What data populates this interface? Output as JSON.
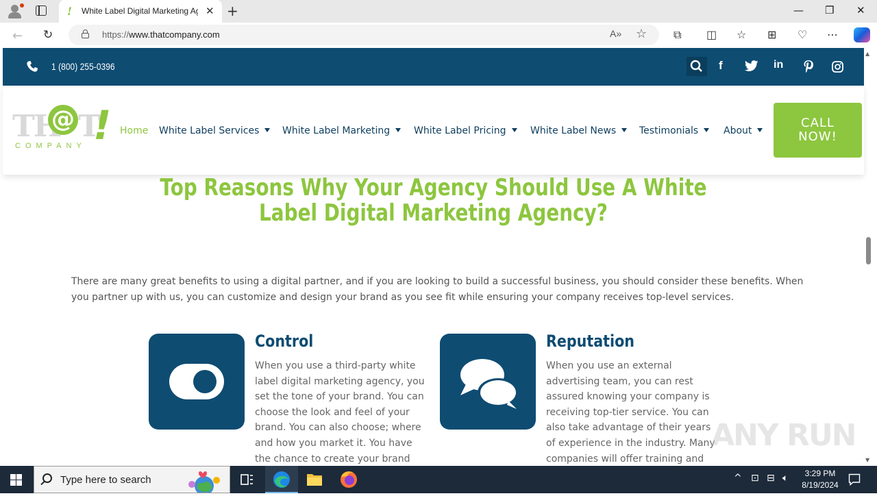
{
  "browser": {
    "tab_title": "White Label Digital Marketing Ag",
    "url_proto": "https://",
    "url_rest": "www.thatcompany.com"
  },
  "topbar": {
    "phone": "1 (800) 255-0396",
    "social": [
      "facebook-icon",
      "twitter-icon",
      "linkedin-icon",
      "pinterest-icon",
      "instagram-icon"
    ]
  },
  "logo": {
    "th": "TH",
    "at": "@",
    "t": "T",
    "bang": "!",
    "company": "COMPANY"
  },
  "nav": {
    "items": [
      {
        "label": "Home"
      },
      {
        "label": "White Label Services"
      },
      {
        "label": "White Label Marketing"
      },
      {
        "label": "White Label Pricing"
      },
      {
        "label": "White Label News"
      },
      {
        "label": "Testimonials"
      },
      {
        "label": "About"
      }
    ],
    "cta_line1": "CALL",
    "cta_line2": "NOW!"
  },
  "main": {
    "headline": "Top Reasons Why Your Agency Should Use A White Label Digital Marketing Agency?",
    "intro": "There are many great benefits to using a digital partner, and if you are looking to build a successful business, you should consider these benefits. When you partner up with us, you can customize and design your brand as you see fit while ensuring your company receives top-level services.",
    "features": [
      {
        "title": "Control",
        "text": "When you use a third-party white label digital marketing agency, you set the tone of your brand. You can choose the look and feel of your brand. You can also choose; where and how you market it. You have the chance to create your brand exactly"
      },
      {
        "title": "Reputation",
        "text": "When you use an external advertising team, you can rest assured knowing your company is receiving top-tier service. You can also take advantage of their years of experience in the industry. Many companies will offer training and different support"
      }
    ]
  },
  "taskbar": {
    "search_placeholder": "Type here to search",
    "time": "3:29 PM",
    "date": "8/19/2024"
  },
  "watermark": "ANY RUN"
}
